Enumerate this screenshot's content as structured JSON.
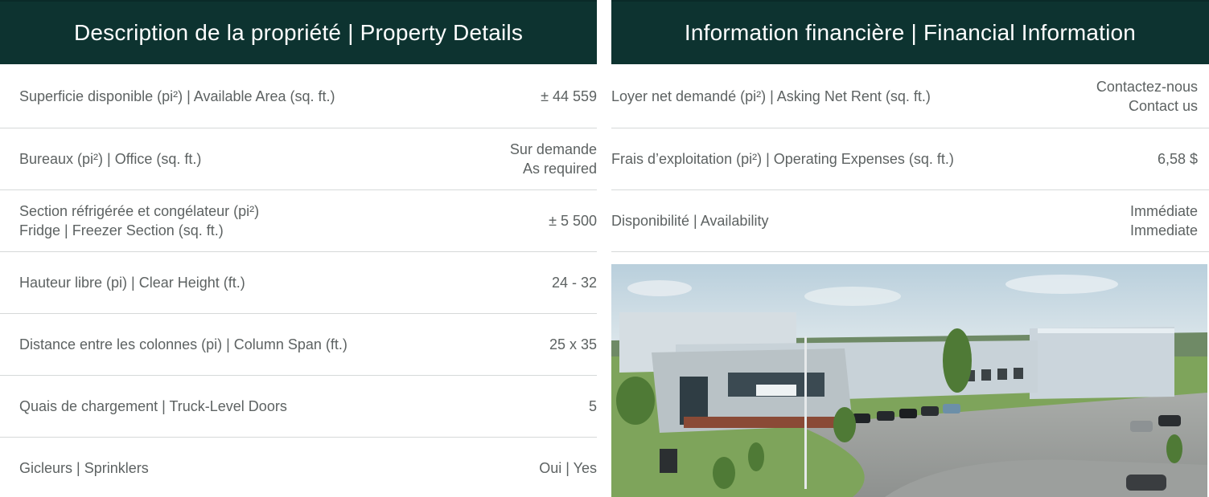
{
  "property": {
    "title": "Description de la propriété | Property Details",
    "rows": [
      {
        "label": "Superficie disponible (pi²) | Available Area (sq. ft.)",
        "value": "± 44 559"
      },
      {
        "label": "Bureaux (pi²) | Office (sq. ft.)",
        "value_line1": "Sur demande",
        "value_line2": "As required"
      },
      {
        "label_line1": "Section réfrigérée et congélateur (pi²)",
        "label_line2": "Fridge | Freezer Section (sq. ft.)",
        "value": "± 5 500"
      },
      {
        "label": "Hauteur libre (pi) | Clear Height (ft.)",
        "value": "24 - 32"
      },
      {
        "label": "Distance entre les colonnes (pi) | Column Span (ft.)",
        "value": "25 x 35"
      },
      {
        "label": "Quais de chargement | Truck-Level Doors",
        "value": "5"
      },
      {
        "label": "Gicleurs | Sprinklers",
        "value": "Oui | Yes"
      }
    ]
  },
  "financial": {
    "title": "Information financière | Financial Information",
    "rows": [
      {
        "label": "Loyer net demandé (pi²) | Asking Net Rent (sq. ft.)",
        "value_line1": "Contactez-nous",
        "value_line2": "Contact us"
      },
      {
        "label": "Frais d’exploitation (pi²) | Operating Expenses (sq. ft.)",
        "value": "6,58 $"
      },
      {
        "label": "Disponibilité | Availability",
        "value_line1": "Immédiate",
        "value_line2": "Immediate"
      }
    ]
  },
  "colors": {
    "header_bg": "#0d3330",
    "divider": "#d6d9d9",
    "text": "#5d6262"
  }
}
